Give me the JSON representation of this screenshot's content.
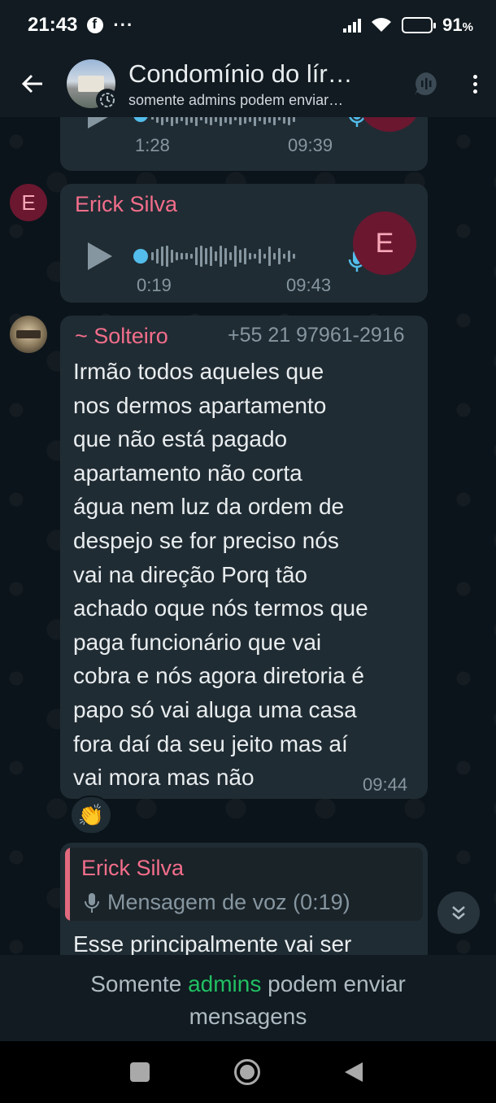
{
  "status_bar": {
    "time": "21:43",
    "more_indicator": "···",
    "battery_pct": "91",
    "battery_unit": "%",
    "battery_level": 0.91,
    "icons": [
      "facebook-icon",
      "signal-icon",
      "wifi-icon",
      "battery-icon"
    ]
  },
  "header": {
    "title": "Condomínio do lír…",
    "subtitle": "somente admins podem enviar…"
  },
  "messages": {
    "m1": {
      "type": "voice",
      "duration": "1:28",
      "time": "09:39"
    },
    "m2": {
      "type": "voice",
      "sender_initial": "E",
      "sender": "Erick Silva",
      "duration": "0:19",
      "time": "09:43",
      "big_avatar_initial": "E"
    },
    "m3": {
      "type": "text",
      "sender": "~ Solteiro",
      "phone": "+55 21 97961-2916",
      "text": "Irmão todos aqueles que\nnos dermos apartamento\nque não está pagado\napartamento não corta\nágua nem luz da ordem de\ndespejo  se for preciso nós\nvai na direção   Porq tão\nachado oque nós termos que\npaga funcionário  que vai\ncobra e nós  agora diretoria é\npapo só  vai aluga uma casa\nfora daí da seu jeito mas aí\nvai mora mas não",
      "time": "09:44",
      "reaction": "👏"
    },
    "m4": {
      "type": "reply",
      "quoted_sender": "Erick Silva",
      "quoted_text": "Mensagem de voz (0:19)",
      "text": "Esse principalmente vai ser"
    }
  },
  "notice": {
    "before": "Somente ",
    "link": "admins",
    "after": " podem enviar",
    "line2": "mensagens"
  },
  "colors": {
    "accent_green": "#21c063",
    "voice_dot": "#53bdeb",
    "sender_pink": "#f36e8b",
    "bubble": "#202c33",
    "background": "#0b141a"
  }
}
